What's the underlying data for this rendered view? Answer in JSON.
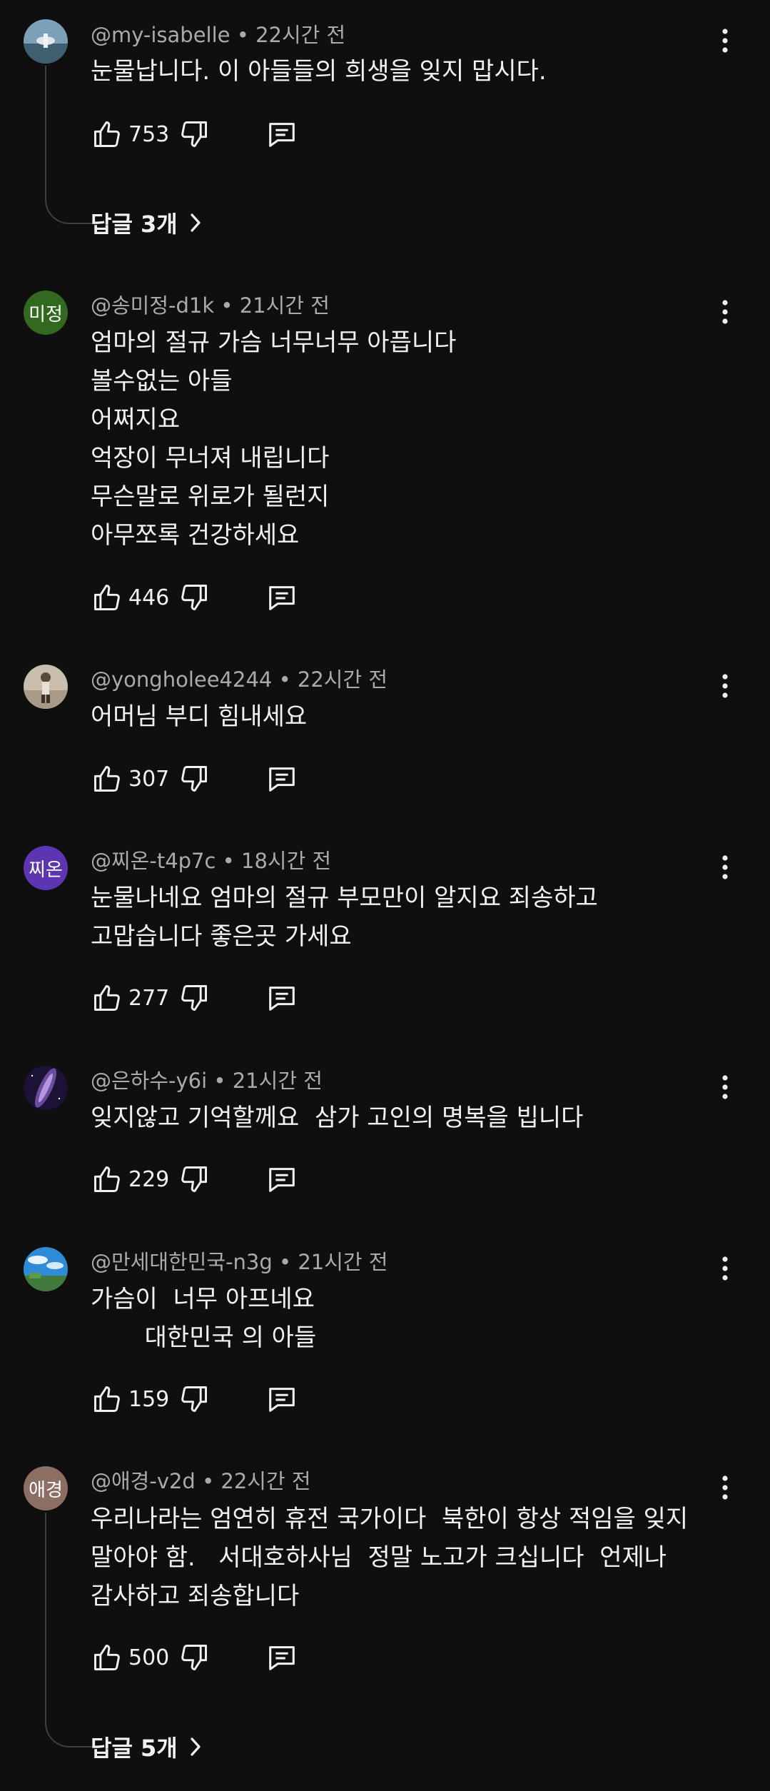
{
  "colors": {
    "background": "#0f0f0f",
    "text": "#f1f1f1",
    "muted": "#aaaaaa",
    "thread_line": "#3f3f3f"
  },
  "comments": [
    {
      "handle": "@my-isabelle",
      "time": "22시간 전",
      "avatar_type": "image",
      "text": "눈물납니다. 이 아들들의 희생을 잊지 맙시다.",
      "likes": "753",
      "replies": "답글 3개"
    },
    {
      "handle": "@송미정-d1k",
      "time": "21시간 전",
      "avatar_type": "initials",
      "avatar_text": "미정",
      "avatar_color": "#33691e",
      "text": "엄마의 절규 가슴 너무너무 아픕니다\n볼수없는 아들\n어쩌지요\n억장이 무너져 내립니다\n무슨말로 위로가 될런지\n아무쪼록 건강하세요",
      "likes": "446"
    },
    {
      "handle": "@yongholee4244",
      "time": "22시간 전",
      "avatar_type": "image",
      "text": "어머님 부디 힘내세요",
      "likes": "307"
    },
    {
      "handle": "@찌온-t4p7c",
      "time": "18시간 전",
      "avatar_type": "initials",
      "avatar_text": "찌온",
      "avatar_color": "#5e35b1",
      "text": "눈물나네요 엄마의 절규 부모만이 알지요 죄송하고\n고맙습니다 좋은곳 가세요",
      "likes": "277"
    },
    {
      "handle": "@은하수-y6i",
      "time": "21시간 전",
      "avatar_type": "image",
      "text": "잊지않고 기억할께요  삼가 고인의 명복을 빕니다",
      "likes": "229"
    },
    {
      "handle": "@만세대한민국-n3g",
      "time": "21시간 전",
      "avatar_type": "image",
      "text": "가슴이  너무 아프네요\n       대한민국 의 아들",
      "likes": "159"
    },
    {
      "handle": "@애경-v2d",
      "time": "22시간 전",
      "avatar_type": "initials",
      "avatar_text": "애경",
      "avatar_color": "#8d6e63",
      "text": "우리나라는 엄연히 휴전 국가이다  북한이 항상 적임을 잊지\n말아야 함.   서대호하사님  정말 노고가 크십니다  언제나\n감사하고 죄송합니다",
      "likes": "500",
      "replies": "답글 5개"
    }
  ]
}
